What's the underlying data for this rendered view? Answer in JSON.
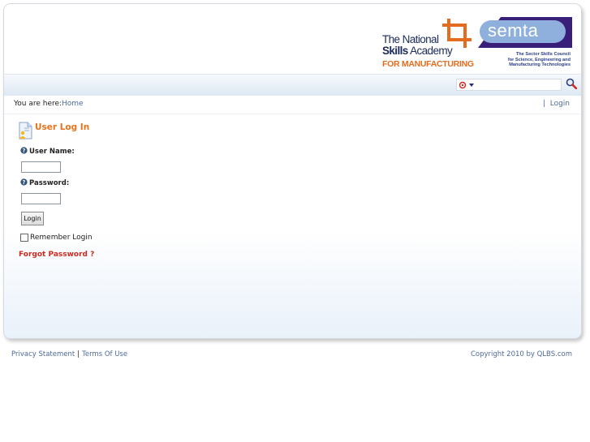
{
  "header": {
    "tnsa_logo": {
      "line1": "The National",
      "line2_bold": "Skills",
      "line2_rest": " Academy",
      "line3": "FOR MANUFACTURING"
    },
    "semta_logo": {
      "word": "semta",
      "tagline": [
        "The Sector Skills Council",
        "for Science, Engineering and",
        "Manufacturing Technologies"
      ]
    },
    "colors": {
      "orange": "#e46c1e",
      "navy": "#1b2a5a",
      "semta_purple": "#3a1f7a",
      "semta_blue": "#8fb0dd"
    }
  },
  "search": {
    "value": "",
    "placeholder": "",
    "scope_icon": "search-scope-icon",
    "button_icon": "magnifier-icon"
  },
  "breadcrumb": {
    "label": "You are here:",
    "home": "Home",
    "right_sep": "|",
    "right_link": "Login"
  },
  "login": {
    "title": "User Log In",
    "username_label": "User Name:",
    "username_value": "",
    "password_label": "Password:",
    "password_value": "",
    "submit_label": "Login",
    "remember_label": "Remember Login",
    "remember_checked": false,
    "forgot_label": "Forgot Password ?"
  },
  "footer": {
    "privacy": "Privacy Statement",
    "sep": "|",
    "terms": "Terms Of Use",
    "copyright": "Copyright 2010 by QLBS.com"
  }
}
